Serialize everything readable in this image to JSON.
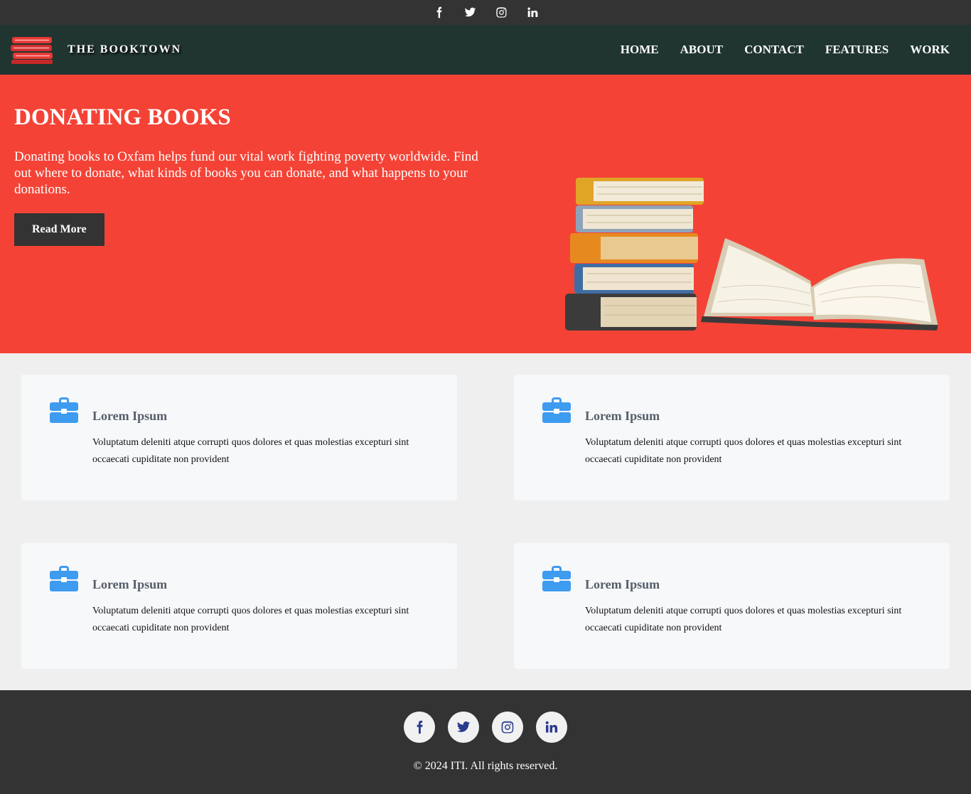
{
  "topbar": {
    "icons": [
      "facebook-icon",
      "twitter-icon",
      "instagram-icon",
      "linkedin-icon"
    ]
  },
  "nav": {
    "brand": "THE BOOKTOWN",
    "items": [
      {
        "label": "HOME"
      },
      {
        "label": "ABOUT"
      },
      {
        "label": "CONTACT"
      },
      {
        "label": "FEATURES"
      },
      {
        "label": "WORK"
      }
    ]
  },
  "hero": {
    "title": "DONATING BOOKS",
    "text": "Donating books to Oxfam helps fund our vital work fighting poverty worldwide. Find out where to donate, what kinds of books you can donate, and what happens to your donations.",
    "button": "Read More"
  },
  "cards": [
    {
      "icon": "briefcase-icon",
      "title": "Lorem Ipsum",
      "text": "Voluptatum deleniti atque corrupti quos dolores et quas molestias excepturi sint occaecati cupiditate non provident"
    },
    {
      "icon": "briefcase-icon",
      "title": "Lorem Ipsum",
      "text": "Voluptatum deleniti atque corrupti quos dolores et quas molestias excepturi sint occaecati cupiditate non provident"
    },
    {
      "icon": "briefcase-icon",
      "title": "Lorem Ipsum",
      "text": "Voluptatum deleniti atque corrupti quos dolores et quas molestias excepturi sint occaecati cupiditate non provident"
    },
    {
      "icon": "briefcase-icon",
      "title": "Lorem Ipsum",
      "text": "Voluptatum deleniti atque corrupti quos dolores et quas molestias excepturi sint occaecati cupiditate non provident"
    }
  ],
  "footer": {
    "icons": [
      "facebook-icon",
      "twitter-icon",
      "instagram-icon",
      "linkedin-icon"
    ],
    "copyright": "© 2024 ITI. All rights reserved."
  },
  "colors": {
    "topbar": "#333333",
    "nav": "#203430",
    "hero": "#f44336",
    "icon_blue": "#3d9bf0",
    "footer": "#333333"
  }
}
